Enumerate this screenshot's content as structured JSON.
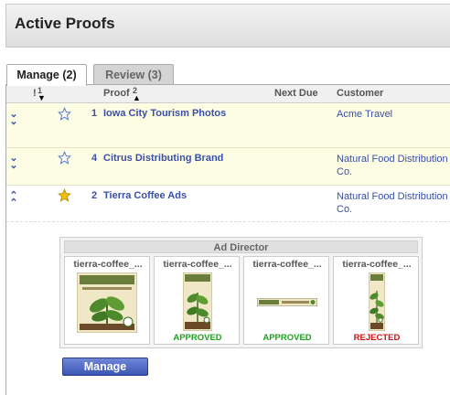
{
  "page": {
    "title": "Active Proofs"
  },
  "tabs": [
    {
      "label": "Manage (2)",
      "active": true
    },
    {
      "label": "Review (3)",
      "active": false
    }
  ],
  "columns": {
    "priority": "!",
    "priority_sort": "1",
    "proof": "Proof",
    "proof_sort": "2",
    "next_due": "Next Due",
    "customer": "Customer"
  },
  "rows": [
    {
      "num": "1",
      "name": "Iowa City Tourism Photos",
      "customer": "Acme Travel",
      "starred": false,
      "expanded": false
    },
    {
      "num": "4",
      "name": "Citrus Distributing Brand",
      "customer": "Natural Food Distribution Co.",
      "starred": false,
      "expanded": false
    },
    {
      "num": "2",
      "name": "Tierra Coffee Ads",
      "customer": "Natural Food Distribution Co.",
      "starred": true,
      "expanded": true
    }
  ],
  "ad_director": {
    "title": "Ad Director",
    "thumbnails": [
      {
        "name": "tierra-coffee_...",
        "status": ""
      },
      {
        "name": "tierra-coffee_...",
        "status": "APPROVED"
      },
      {
        "name": "tierra-coffee_...",
        "status": "APPROVED"
      },
      {
        "name": "tierra-coffee_...",
        "status": "REJECTED"
      }
    ]
  },
  "actions": {
    "manage_label": "Manage"
  },
  "colors": {
    "link": "#3a4fa8",
    "row_highlight": "#fdfde3",
    "approved": "#1aa31a",
    "rejected": "#cc1111",
    "star": "#f2c200"
  }
}
